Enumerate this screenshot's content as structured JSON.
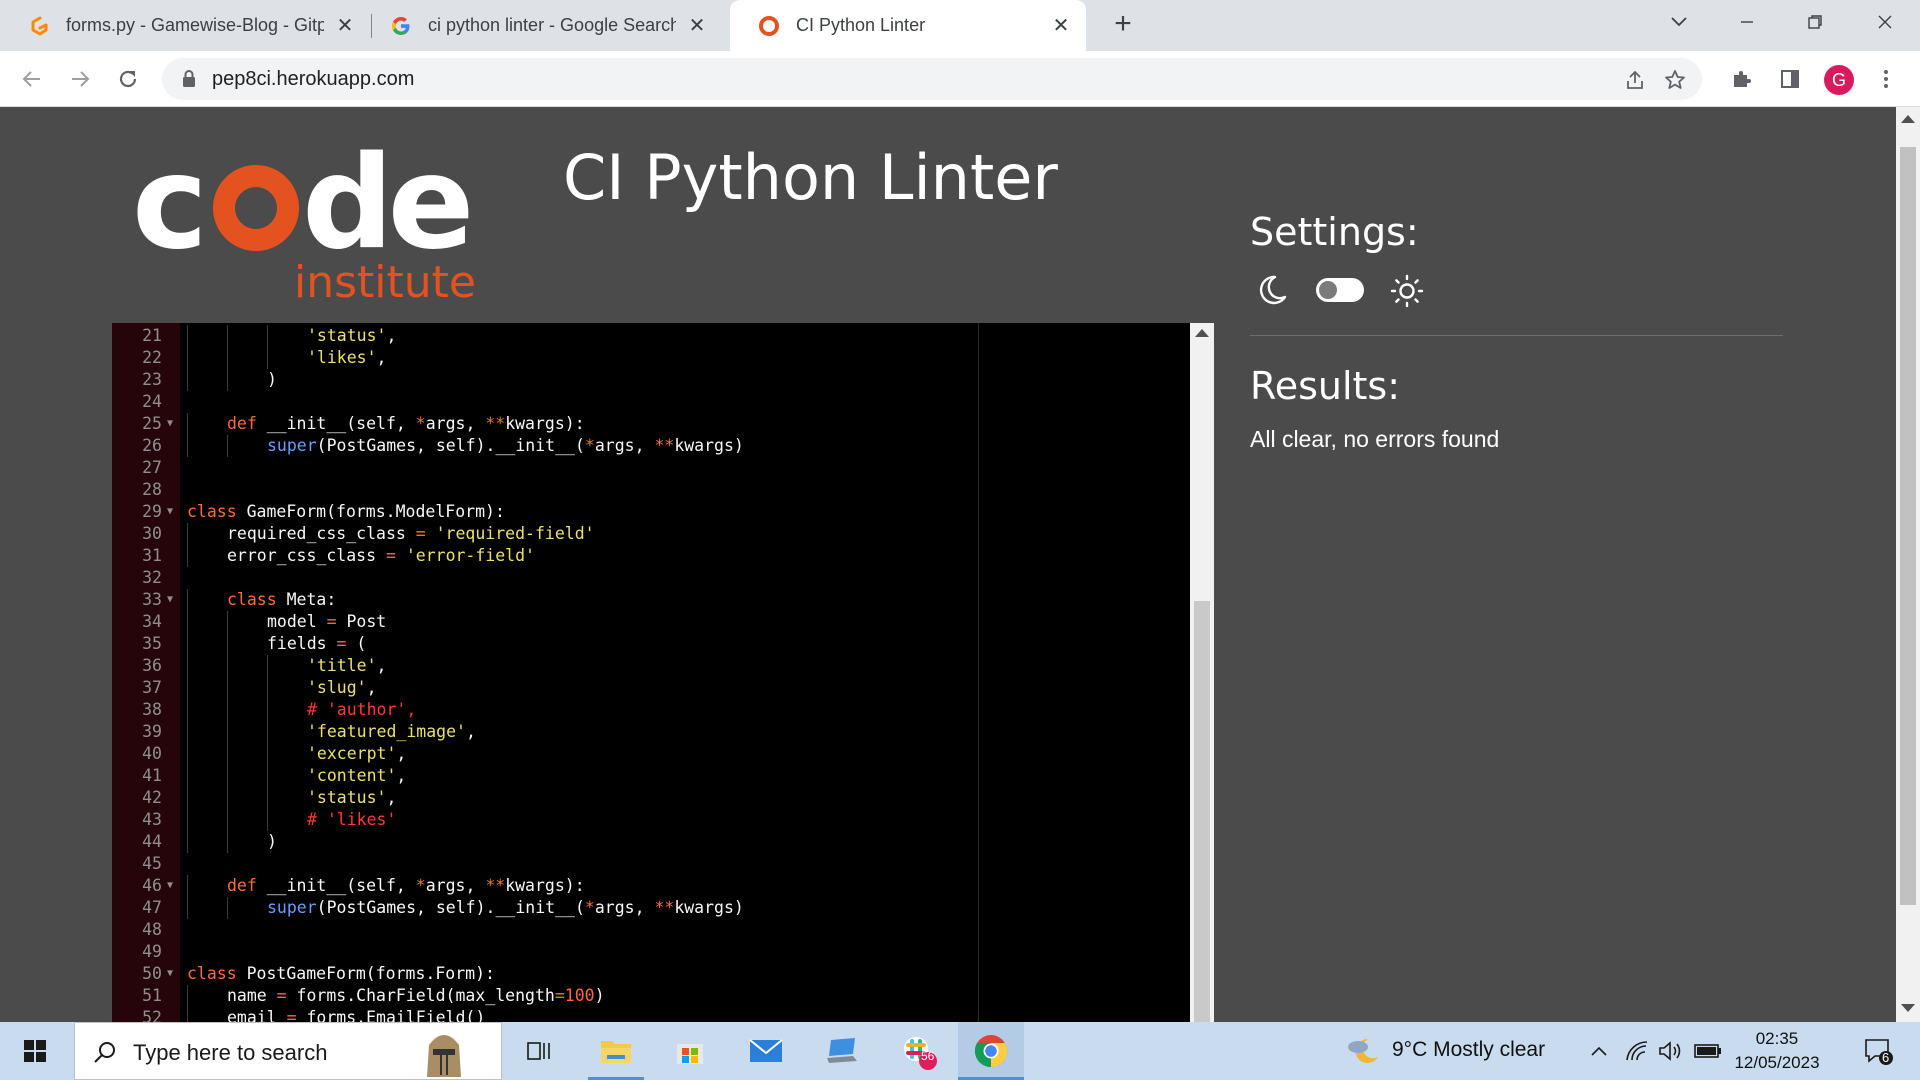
{
  "browser": {
    "tabs": [
      {
        "title": "forms.py - Gamewise-Blog - Gitpod",
        "favicon": "gitpod-icon",
        "active": false
      },
      {
        "title": "ci python linter - Google Search",
        "favicon": "google-icon",
        "active": false
      },
      {
        "title": "CI Python Linter",
        "favicon": "code-institute-icon",
        "active": true
      }
    ],
    "url": "pep8ci.herokuapp.com",
    "profile_initial": "G",
    "profile_color": "#d81b60"
  },
  "page": {
    "title": "CI Python Linter",
    "logo": {
      "word": "code",
      "sub": "institute",
      "accent": "#e4531f"
    },
    "settings_title": "Settings:",
    "results_title": "Results:",
    "results_text": "All clear, no errors found",
    "theme_toggle": "dark"
  },
  "editor": {
    "lines": [
      {
        "n": "21",
        "fold": false,
        "indent": 3,
        "html": "<span class='str'>'status'</span>,"
      },
      {
        "n": "22",
        "fold": false,
        "indent": 3,
        "html": "<span class='str'>'likes'</span>,"
      },
      {
        "n": "23",
        "fold": false,
        "indent": 2,
        "html": ")"
      },
      {
        "n": "24",
        "fold": false,
        "indent": 0,
        "html": ""
      },
      {
        "n": "25",
        "fold": true,
        "indent": 1,
        "html": "<span class='kw'>def</span> __init__(self, <span class='op'>*</span>args, <span class='op'>**</span>kwargs):"
      },
      {
        "n": "26",
        "fold": false,
        "indent": 2,
        "html": "<span class='bi'>super</span>(PostGames, self).__init__(<span class='op'>*</span>args, <span class='op'>**</span>kwargs)"
      },
      {
        "n": "27",
        "fold": false,
        "indent": 0,
        "html": ""
      },
      {
        "n": "28",
        "fold": false,
        "indent": 0,
        "html": ""
      },
      {
        "n": "29",
        "fold": true,
        "indent": 0,
        "html": "<span class='kw'>class</span> GameForm(forms.ModelForm):"
      },
      {
        "n": "30",
        "fold": false,
        "indent": 1,
        "html": "required_css_class <span class='op'>=</span> <span class='str'>'required-field'</span>"
      },
      {
        "n": "31",
        "fold": false,
        "indent": 1,
        "html": "error_css_class <span class='op'>=</span> <span class='str'>'error-field'</span>"
      },
      {
        "n": "32",
        "fold": false,
        "indent": 0,
        "html": ""
      },
      {
        "n": "33",
        "fold": true,
        "indent": 1,
        "html": "<span class='kw'>class</span> Meta:"
      },
      {
        "n": "34",
        "fold": false,
        "indent": 2,
        "html": "model <span class='op'>=</span> Post"
      },
      {
        "n": "35",
        "fold": false,
        "indent": 2,
        "html": "fields <span class='op'>=</span> ("
      },
      {
        "n": "36",
        "fold": false,
        "indent": 3,
        "html": "<span class='str'>'title'</span>,"
      },
      {
        "n": "37",
        "fold": false,
        "indent": 3,
        "html": "<span class='str'>'slug'</span>,"
      },
      {
        "n": "38",
        "fold": false,
        "indent": 3,
        "html": "<span class='cm'># 'author',</span>"
      },
      {
        "n": "39",
        "fold": false,
        "indent": 3,
        "html": "<span class='str'>'featured_image'</span>,"
      },
      {
        "n": "40",
        "fold": false,
        "indent": 3,
        "html": "<span class='str'>'excerpt'</span>,"
      },
      {
        "n": "41",
        "fold": false,
        "indent": 3,
        "html": "<span class='str'>'content'</span>,"
      },
      {
        "n": "42",
        "fold": false,
        "indent": 3,
        "html": "<span class='str'>'status'</span>,"
      },
      {
        "n": "43",
        "fold": false,
        "indent": 3,
        "html": "<span class='cm'># 'likes'</span>"
      },
      {
        "n": "44",
        "fold": false,
        "indent": 2,
        "html": ")"
      },
      {
        "n": "45",
        "fold": false,
        "indent": 0,
        "html": ""
      },
      {
        "n": "46",
        "fold": true,
        "indent": 1,
        "html": "<span class='kw'>def</span> __init__(self, <span class='op'>*</span>args, <span class='op'>**</span>kwargs):"
      },
      {
        "n": "47",
        "fold": false,
        "indent": 2,
        "html": "<span class='bi'>super</span>(PostGames, self).__init__(<span class='op'>*</span>args, <span class='op'>**</span>kwargs)"
      },
      {
        "n": "48",
        "fold": false,
        "indent": 0,
        "html": ""
      },
      {
        "n": "49",
        "fold": false,
        "indent": 0,
        "html": ""
      },
      {
        "n": "50",
        "fold": true,
        "indent": 0,
        "html": "<span class='kw'>class</span> PostGameForm(forms.Form):"
      },
      {
        "n": "51",
        "fold": false,
        "indent": 1,
        "html": "name <span class='op'>=</span> forms.CharField(max_length<span class='op'>=</span><span class='op'>100</span>)"
      },
      {
        "n": "52",
        "fold": false,
        "indent": 1,
        "html": "email <span class='op'>=</span> forms.EmailField()"
      }
    ]
  },
  "taskbar": {
    "search_placeholder": "Type here to search",
    "weather": "9°C  Mostly clear",
    "time": "02:35",
    "date": "12/05/2023",
    "slack_badge": "56",
    "notifications": "6"
  }
}
